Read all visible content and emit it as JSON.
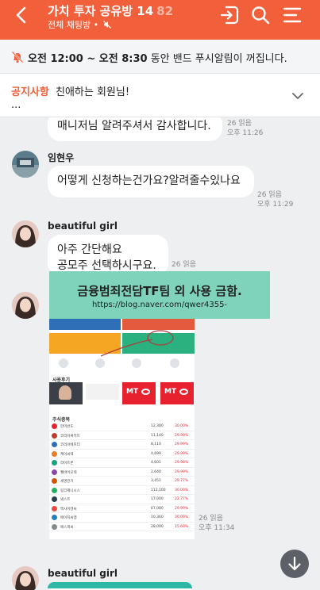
{
  "header": {
    "title": "가치 투자 공유방 14",
    "member_count": "82",
    "subtitle": "전체 채팅방 •"
  },
  "mute_notice": {
    "start": "오전 12:00",
    "sep": " ~ ",
    "end": "오전 8:30",
    "rest": " 동안 밴드 푸시알림이 꺼집니다."
  },
  "notice": {
    "label": "공지사항",
    "text": "친애하는 회원님!",
    "more": "..."
  },
  "messages": [
    {
      "text": "매니저님 알려주셔서 감사합니다.",
      "read": "26 읽음",
      "time": "오후 11:26"
    },
    {
      "sender": "임현우",
      "text": "어떻게 신청하는건가요?알려줄수있나요",
      "read": "26 읽음",
      "time": "오후 11:29"
    },
    {
      "sender": "beautiful girl",
      "line1": "아주 간단해요",
      "line2": "공모주 선택하시구요.",
      "read": "26 읽음"
    },
    {
      "read": "26 읽음",
      "time": "오후 11:34"
    },
    {
      "sender": "beautiful girl"
    }
  ],
  "watermark": {
    "title": "금융범죄전담TF팀 외 사용 금함.",
    "url": "https://blog.naver.com/qwer4355-"
  },
  "screenshot": {
    "section1": "사용후기",
    "section2": "주식종목",
    "brand": "MT",
    "stocks": [
      {
        "name": "한미반도",
        "price": "12,300",
        "pct": "30.00%"
      },
      {
        "name": "코리아써키트",
        "price": "11,140",
        "pct": "29.99%"
      },
      {
        "name": "코리아에프티",
        "price": "8,110",
        "pct": "29.99%"
      },
      {
        "name": "케이씨텍",
        "price": "4,699",
        "pct": "29.99%"
      },
      {
        "name": "라이트론",
        "price": "4,601",
        "pct": "29.98%"
      },
      {
        "name": "웰바이오텍",
        "price": "2,640",
        "pct": "29.99%"
      },
      {
        "name": "세명전기",
        "price": "3,451",
        "pct": "29.77%"
      },
      {
        "name": "링크제니시스",
        "price": "112,100",
        "pct": "30.00%"
      },
      {
        "name": "넥스트",
        "price": "17,000",
        "pct": "22.77%"
      },
      {
        "name": "엑사이엔씨",
        "price": "67,000",
        "pct": "29.99%"
      },
      {
        "name": "에이치씨엠",
        "price": "10,360",
        "pct": "30.00%"
      },
      {
        "name": "에스피씨",
        "price": "28,000",
        "pct": "15.60%"
      }
    ]
  },
  "colors": {
    "brand": "#f2603b",
    "watermark": "#7fd3bb",
    "fab": "#5d6067"
  }
}
